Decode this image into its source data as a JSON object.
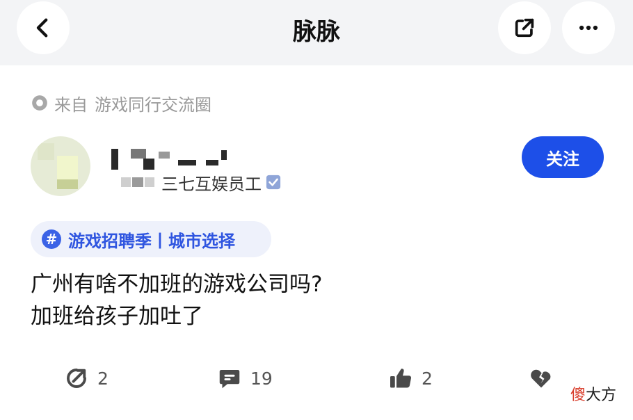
{
  "nav": {
    "title": "脉脉",
    "back_icon": "chevron-left-icon",
    "share_icon": "external-share-icon",
    "more_icon": "more-horizontal-icon"
  },
  "source": {
    "prefix": "来自",
    "circle_name": "游戏同行交流圈"
  },
  "author": {
    "company_title": "三七互娱员工",
    "verified": true,
    "follow_label": "关注"
  },
  "topic": {
    "label": "游戏招聘季丨城市选择"
  },
  "post": {
    "line1": "广州有啥不加班的游戏公司吗?",
    "line2": "加班给孩子加吐了"
  },
  "actions": {
    "repost_count": "2",
    "comment_count": "19",
    "like_count": "2"
  },
  "watermark": {
    "first_char": "傻",
    "rest": "大方"
  },
  "colors": {
    "accent": "#1d4fe8",
    "topic_text": "#2f55e0",
    "topic_bg": "#eef1fb",
    "navbar_bg": "#f3f4f6",
    "muted_text": "#9a9a9a"
  }
}
